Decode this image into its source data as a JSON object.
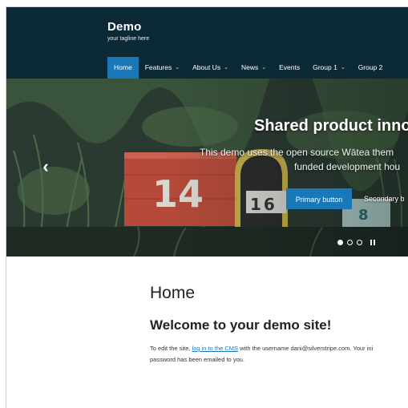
{
  "site": {
    "title": "Demo",
    "tagline": "your tagline here"
  },
  "nav": {
    "items": [
      {
        "label": "Home",
        "active": true,
        "has_dropdown": false
      },
      {
        "label": "Features",
        "active": false,
        "has_dropdown": true
      },
      {
        "label": "About Us",
        "active": false,
        "has_dropdown": true
      },
      {
        "label": "News",
        "active": false,
        "has_dropdown": true
      },
      {
        "label": "Events",
        "active": false,
        "has_dropdown": false
      },
      {
        "label": "Group 1",
        "active": false,
        "has_dropdown": true
      },
      {
        "label": "Group 2",
        "active": false,
        "has_dropdown": false
      }
    ],
    "dropdown_glyph": "⌄"
  },
  "hero": {
    "title": "Shared product inno",
    "description_line1": "This demo uses the open source Wātea them",
    "description_line2": "funded development hou",
    "primary_button": "Primary button",
    "secondary_button": "Secondary b",
    "prev_arrow": "‹",
    "mailbox_number_1": "14",
    "mailbox_number_2": "16",
    "mailbox_number_3": "8",
    "slides": [
      true,
      false,
      false
    ]
  },
  "content": {
    "page_title": "Home",
    "subtitle": "Welcome to your demo site!",
    "body_pre": "To edit the site, ",
    "body_link": "log in to the CMS",
    "body_post": " with the username dani@silverstripe.com. Your ini",
    "body_line2": "password has been emailed to you."
  },
  "colors": {
    "header_bg": "#0c2a35",
    "accent": "#1a78b8",
    "text": "#222222"
  }
}
